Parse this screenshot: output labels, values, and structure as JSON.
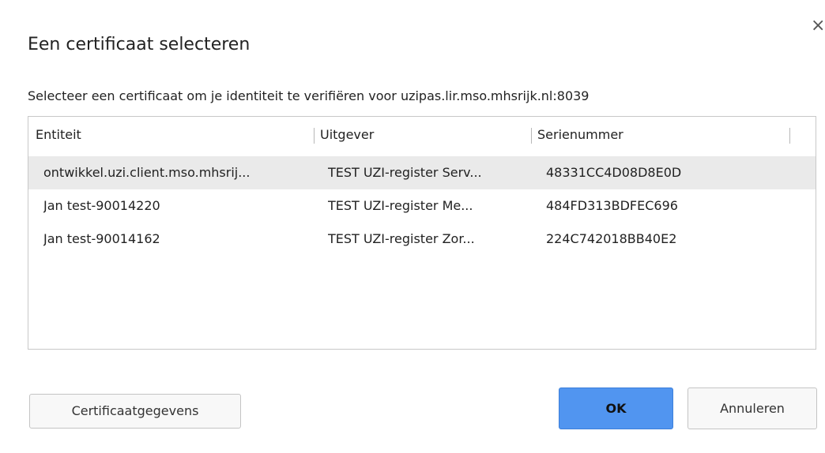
{
  "dialog": {
    "title": "Een certificaat selecteren",
    "close_glyph": "×",
    "subtitle": "Selecteer een certificaat om je identiteit te verifiëren voor uzipas.lir.mso.mhsrijk.nl:8039"
  },
  "table": {
    "columns": [
      "Entiteit",
      "Uitgever",
      "Serienummer"
    ],
    "rows": [
      {
        "entity": "ontwikkel.uzi.client.mso.mhsrij...",
        "issuer": "TEST UZI-register Serv...",
        "serial": "48331CC4D08D8E0D",
        "selected": true
      },
      {
        "entity": "Jan test-90014220",
        "issuer": "TEST UZI-register Me...",
        "serial": "484FD313BDFEC696",
        "selected": false
      },
      {
        "entity": "Jan test-90014162",
        "issuer": "TEST UZI-register Zor...",
        "serial": "224C742018BB40E2",
        "selected": false
      }
    ]
  },
  "buttons": {
    "details": "Certificaatgegevens",
    "ok": "OK",
    "cancel": "Annuleren"
  },
  "colors": {
    "primary": "#5195f0",
    "selected_row": "#eaeaea",
    "border": "#c8c8c8"
  }
}
